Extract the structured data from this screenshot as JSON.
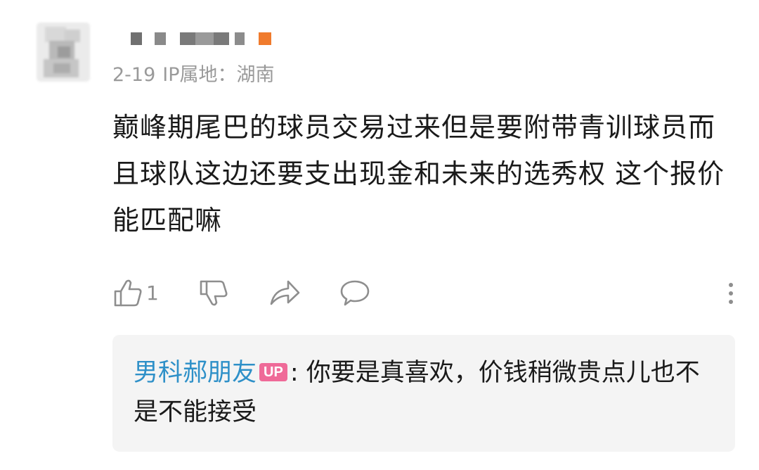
{
  "comment": {
    "date": "2-19",
    "ip_location": "IP属地：湖南",
    "text": "巅峰期尾巴的球员交易过来但是要附带青训球员而且球队这边还要支出现金和未来的选秀权  这个报价能匹配嘛",
    "like_count": "1",
    "icons": {
      "like": "thumbs-up-icon",
      "dislike": "thumbs-down-icon",
      "share": "share-icon",
      "reply": "comment-icon",
      "more": "more-vertical-icon"
    }
  },
  "reply": {
    "author": "男科郝朋友",
    "badge": "UP",
    "separator": ": ",
    "text": "你要是真喜欢，价钱稍微贵点儿也不是不能接受"
  },
  "colors": {
    "reply_name": "#2e90c8",
    "up_badge": "#ef6a98",
    "reply_bg": "#f4f4f4",
    "muted": "#9a9a9a"
  }
}
